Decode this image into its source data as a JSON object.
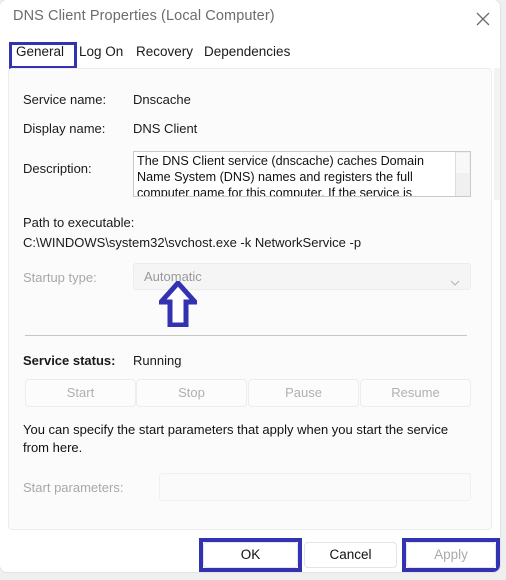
{
  "window": {
    "title": "DNS Client Properties (Local Computer)",
    "close_icon": "close-icon"
  },
  "tabs": [
    {
      "id": "general",
      "label": "General",
      "selected": true
    },
    {
      "id": "logon",
      "label": "Log On",
      "selected": false
    },
    {
      "id": "recovery",
      "label": "Recovery",
      "selected": false
    },
    {
      "id": "dependencies",
      "label": "Dependencies",
      "selected": false
    }
  ],
  "general": {
    "service_name_label": "Service name:",
    "service_name_value": "Dnscache",
    "display_name_label": "Display name:",
    "display_name_value": "DNS Client",
    "description_label": "Description:",
    "description_value": "The DNS Client service (dnscache) caches Domain Name System (DNS) names and registers the full computer name for this computer. If the service is",
    "path_label": "Path to executable:",
    "path_value": "C:\\WINDOWS\\system32\\svchost.exe -k NetworkService -p",
    "startup_type_label": "Startup type:",
    "startup_type_value": "Automatic",
    "startup_chevron_icon": "chevron-down-icon",
    "service_status_label": "Service status:",
    "service_status_value": "Running",
    "buttons": {
      "start": "Start",
      "stop": "Stop",
      "pause": "Pause",
      "resume": "Resume"
    },
    "help_text": "You can specify the start parameters that apply when you start the service from here.",
    "start_parameters_label": "Start parameters:",
    "start_parameters_value": "",
    "start_parameters_placeholder": ""
  },
  "footer": {
    "ok": "OK",
    "cancel": "Cancel",
    "apply": "Apply"
  },
  "annotations": {
    "color": "#3333b2",
    "highlight_tab": "General",
    "highlight_ok": "OK",
    "highlight_apply": "Apply",
    "arrow_points_to": "Startup type dropdown"
  }
}
